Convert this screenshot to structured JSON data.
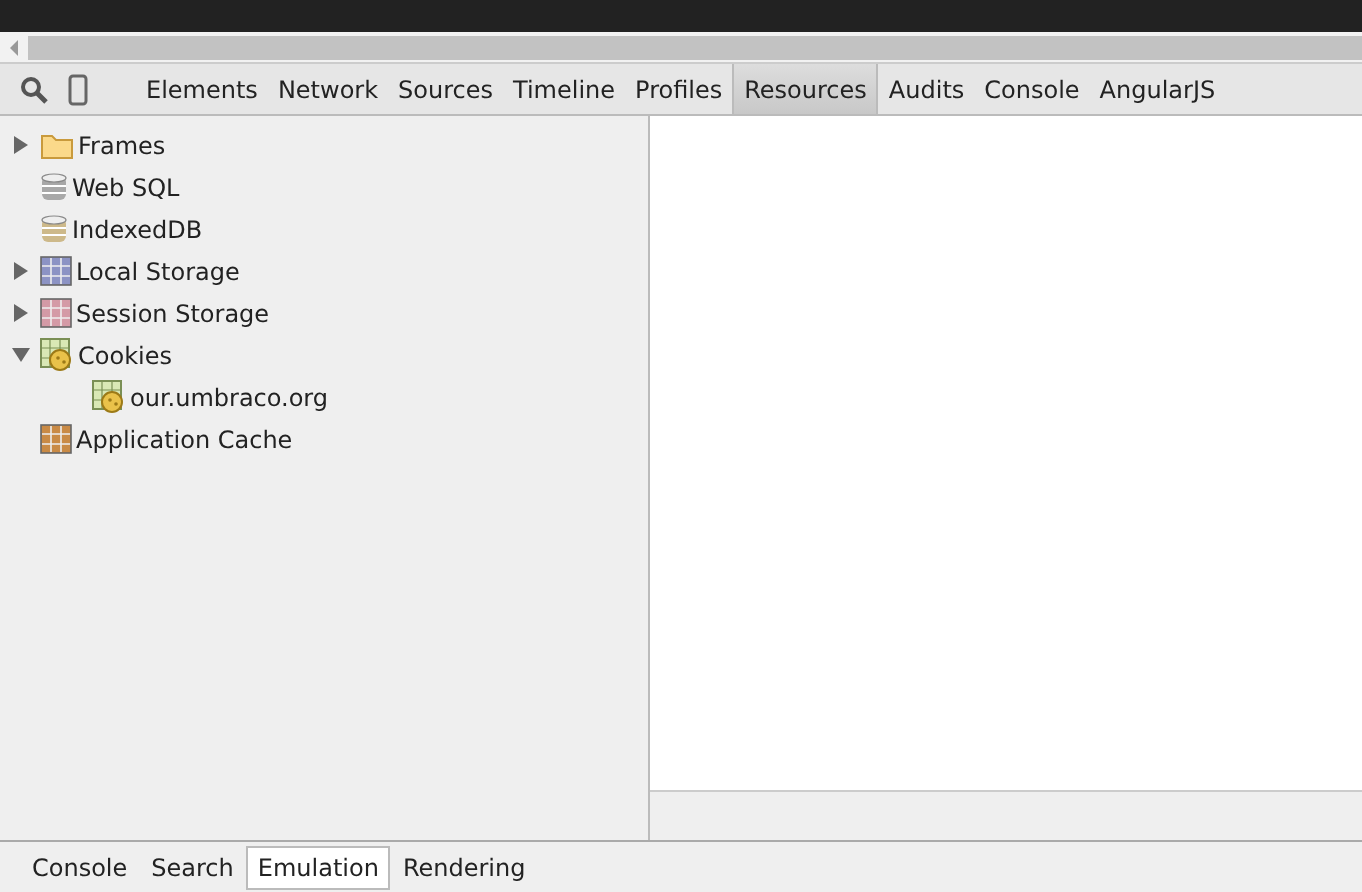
{
  "toolbar": {
    "tabs": [
      {
        "label": "Elements",
        "selected": false
      },
      {
        "label": "Network",
        "selected": false
      },
      {
        "label": "Sources",
        "selected": false
      },
      {
        "label": "Timeline",
        "selected": false
      },
      {
        "label": "Profiles",
        "selected": false
      },
      {
        "label": "Resources",
        "selected": true
      },
      {
        "label": "Audits",
        "selected": false
      },
      {
        "label": "Console",
        "selected": false
      },
      {
        "label": "AngularJS",
        "selected": false
      }
    ]
  },
  "sidebar": {
    "items": [
      {
        "label": "Frames",
        "kind": "folder",
        "expanded": false
      },
      {
        "label": "Web SQL",
        "kind": "database",
        "color": "#a8a8a8"
      },
      {
        "label": "IndexedDB",
        "kind": "database",
        "color": "#cdb98a"
      },
      {
        "label": "Local Storage",
        "kind": "grid",
        "color": "#8c93c4",
        "expanded": false
      },
      {
        "label": "Session Storage",
        "kind": "grid",
        "color": "#d49aa6",
        "expanded": false
      },
      {
        "label": "Cookies",
        "kind": "cookie",
        "expanded": true,
        "children": [
          {
            "label": "our.umbraco.org",
            "kind": "cookie"
          }
        ]
      },
      {
        "label": "Application Cache",
        "kind": "grid",
        "color": "#c98a45"
      }
    ]
  },
  "drawer": {
    "tabs": [
      {
        "label": "Console",
        "selected": false
      },
      {
        "label": "Search",
        "selected": false
      },
      {
        "label": "Emulation",
        "selected": true
      },
      {
        "label": "Rendering",
        "selected": false
      }
    ]
  }
}
